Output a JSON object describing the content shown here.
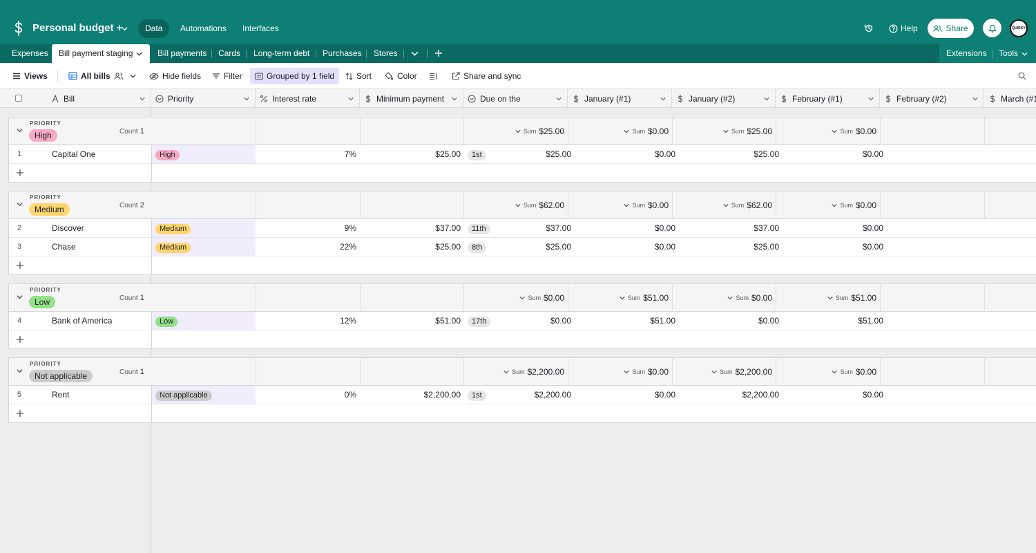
{
  "app": {
    "base_name": "Personal budget +",
    "nav": [
      "Data",
      "Automations",
      "Interfaces"
    ],
    "help_label": "Help",
    "share_label": "Share",
    "avatar_text": "QUIRKY",
    "brand_color": "#0d7f74"
  },
  "tabs": {
    "items": [
      "Expenses",
      "Bill payment staging",
      "Bill payments",
      "Cards",
      "Long-term debt",
      "Purchases",
      "Stores"
    ],
    "active": "Bill payment staging",
    "extensions": "Extensions",
    "tools": "Tools"
  },
  "toolbar": {
    "views": "Views",
    "view_name": "All bills",
    "hide_fields": "Hide fields",
    "filter": "Filter",
    "grouped": "Grouped by 1 field",
    "sort": "Sort",
    "color": "Color",
    "share_sync": "Share and sync"
  },
  "columns": [
    "Bill",
    "Priority",
    "Interest rate",
    "Minimum payment",
    "Due on the",
    "January (#1)",
    "January (#2)",
    "February (#1)",
    "February (#2)",
    "March (#1"
  ],
  "group_label": "PRIORITY",
  "count_label": "Count",
  "sum_label": "Sum",
  "groups": [
    {
      "name": "High",
      "color": "#f8a9c4",
      "count": "1",
      "sums": [
        "$25.00",
        "$0.00",
        "$25.00",
        "$0.00"
      ],
      "rows": [
        {
          "n": "1",
          "bill": "Capital One",
          "priority": "High",
          "interest": "7%",
          "min": "$25.00",
          "due": "1st",
          "m": [
            "$25.00",
            "$0.00",
            "$25.00",
            "$0.00"
          ]
        }
      ]
    },
    {
      "name": "Medium",
      "color": "#ffd66e",
      "count": "2",
      "sums": [
        "$62.00",
        "$0.00",
        "$62.00",
        "$0.00"
      ],
      "rows": [
        {
          "n": "2",
          "bill": "Discover",
          "priority": "Medium",
          "interest": "9%",
          "min": "$37.00",
          "due": "11th",
          "m": [
            "$37.00",
            "$0.00",
            "$37.00",
            "$0.00"
          ]
        },
        {
          "n": "3",
          "bill": "Chase",
          "priority": "Medium",
          "interest": "22%",
          "min": "$25.00",
          "due": "8th",
          "m": [
            "$25.00",
            "$0.00",
            "$25.00",
            "$0.00"
          ]
        }
      ]
    },
    {
      "name": "Low",
      "color": "#93e088",
      "count": "1",
      "sums": [
        "$0.00",
        "$51.00",
        "$0.00",
        "$51.00"
      ],
      "rows": [
        {
          "n": "4",
          "bill": "Bank of America",
          "priority": "Low",
          "interest": "12%",
          "min": "$51.00",
          "due": "17th",
          "m": [
            "$0.00",
            "$51.00",
            "$0.00",
            "$51.00"
          ]
        }
      ]
    },
    {
      "name": "Not applicable",
      "color": "#cccccc",
      "count": "1",
      "sums": [
        "$2,200.00",
        "$0.00",
        "$2,200.00",
        "$0.00"
      ],
      "rows": [
        {
          "n": "5",
          "bill": "Rent",
          "priority": "Not applicable",
          "interest": "0%",
          "min": "$2,200.00",
          "due": "1st",
          "m": [
            "$2,200.00",
            "$0.00",
            "$2,200.00",
            "$0.00"
          ]
        }
      ]
    }
  ]
}
